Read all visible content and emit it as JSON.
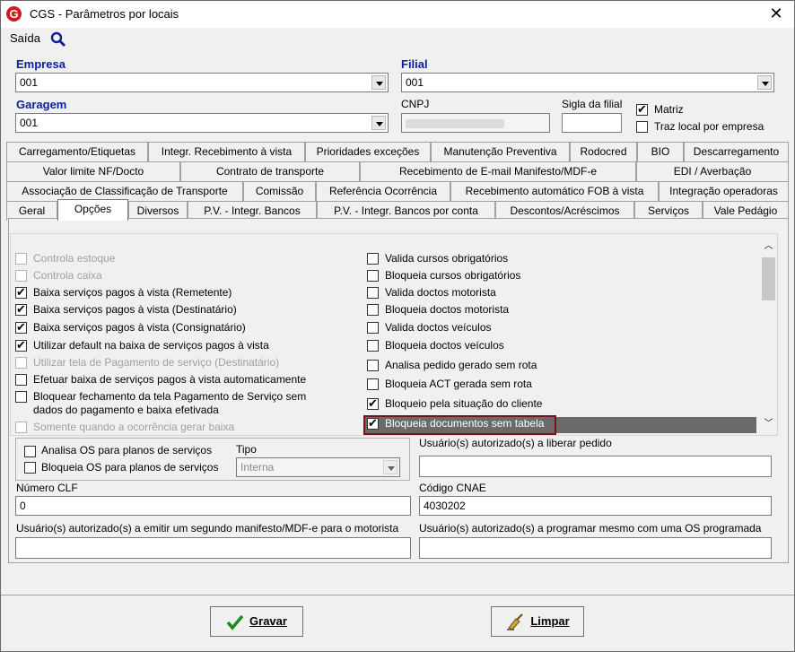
{
  "window": {
    "title": "CGS - Parâmetros por locais"
  },
  "menu": {
    "saida": "Saída"
  },
  "form": {
    "empresa_label": "Empresa",
    "empresa_value": "001",
    "filial_label": "Filial",
    "filial_value": "001",
    "garagem_label": "Garagem",
    "garagem_value": "001",
    "cnpj_label": "CNPJ",
    "sigla_label": "Sigla da filial",
    "matriz_label": "Matriz",
    "traz_local_label": "Traz local por empresa"
  },
  "tabs": {
    "row1": [
      "Carregamento/Etiquetas",
      "Integr. Recebimento à vista",
      "Prioridades exceções",
      "Manutenção Preventiva",
      "Rodocred",
      "BIO",
      "Descarregamento"
    ],
    "row2": [
      "Valor limite NF/Docto",
      "Contrato de transporte",
      "Recebimento de E-mail Manifesto/MDF-e",
      "EDI / Averbação"
    ],
    "row3": [
      "Associação de Classificação de Transporte",
      "Comissão",
      "Referência Ocorrência",
      "Recebimento automático FOB à vista",
      "Integração operadoras"
    ],
    "row4": [
      "Geral",
      "Opções",
      "Diversos",
      "P.V. - Integr. Bancos",
      "P.V. - Integr. Bancos por conta",
      "Descontos/Acréscimos",
      "Serviços",
      "Vale Pedágio"
    ]
  },
  "options_left": [
    {
      "label": "Controla estoque",
      "checked": false,
      "disabled": true
    },
    {
      "label": "Controla caixa",
      "checked": false,
      "disabled": true
    },
    {
      "label": "Baixa serviços pagos à vista (Remetente)",
      "checked": true,
      "disabled": false
    },
    {
      "label": "Baixa serviços pagos à vista (Destinatário)",
      "checked": true,
      "disabled": false
    },
    {
      "label": "Baixa serviços pagos à vista (Consignatário)",
      "checked": true,
      "disabled": false
    },
    {
      "label": "Utilizar default na baixa de serviços pagos à vista",
      "checked": true,
      "disabled": false
    },
    {
      "label": "Utilizar tela de Pagamento de serviço (Destinatário)",
      "checked": false,
      "disabled": true
    },
    {
      "label": "Efetuar baixa de serviços pagos à vista automaticamente",
      "checked": false,
      "disabled": false
    },
    {
      "label": "Bloquear fechamento da tela Pagamento de Serviço sem",
      "label2": "dados do pagamento e baixa efetivada",
      "checked": false,
      "disabled": false
    },
    {
      "label": "Somente quando a ocorrência gerar baixa",
      "checked": false,
      "disabled": true
    }
  ],
  "options_right": [
    {
      "label": "Valida cursos obrigatórios",
      "checked": false
    },
    {
      "label": "Bloqueia cursos obrigatórios",
      "checked": false
    },
    {
      "label": "Valida doctos motorista",
      "checked": false
    },
    {
      "label": "Bloqueia doctos motorista",
      "checked": false
    },
    {
      "label": "Valida doctos veículos",
      "checked": false
    },
    {
      "label": "Bloqueia doctos veículos",
      "checked": false
    },
    {
      "label": "Analisa pedido gerado sem rota",
      "checked": false
    },
    {
      "label": "Bloqueia ACT gerada sem rota",
      "checked": false
    },
    {
      "label": "Bloqueio pela situação do cliente",
      "checked": true
    },
    {
      "label": "Bloqueia documentos sem tabela",
      "checked": true
    }
  ],
  "os": {
    "analisa_label": "Analisa OS para planos de serviços",
    "bloqueia_label": "Bloqueia OS para planos de serviços",
    "tipo_label": "Tipo",
    "tipo_value": "Interna"
  },
  "fields": {
    "usuarios_liberar_label": "Usuário(s) autorizado(s) a liberar pedido",
    "numero_clf_label": "Número CLF",
    "numero_clf_value": "0",
    "cnae_label": "Código CNAE",
    "cnae_value": "4030202",
    "usuarios_manifesto_label": "Usuário(s) autorizado(s) a emitir um segundo manifesto/MDF-e para o motorista",
    "usuarios_programar_label": "Usuário(s) autorizado(s) a programar mesmo com uma OS programada"
  },
  "buttons": {
    "gravar": "Gravar",
    "limpar": "Limpar"
  },
  "colors": {
    "label_blue": "#0a1f9c",
    "highlight": "#6a6a6a",
    "highlight_border": "#7a1414",
    "logo_red": "#d61a1a"
  }
}
